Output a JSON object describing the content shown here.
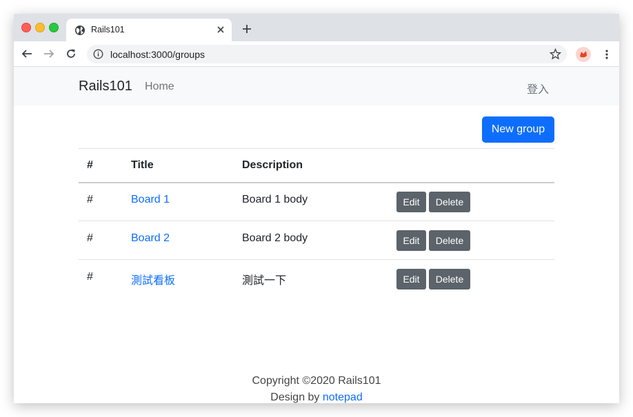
{
  "browser": {
    "tab_title": "Rails101",
    "url": "localhost:3000/groups"
  },
  "navbar": {
    "brand": "Rails101",
    "home": "Home",
    "login": "登入"
  },
  "actions": {
    "new_group": "New group"
  },
  "table": {
    "headers": [
      "#",
      "Title",
      "Description"
    ],
    "rows": [
      {
        "hash": "#",
        "title": "Board 1",
        "description": "Board 1 body",
        "edit": "Edit",
        "delete": "Delete"
      },
      {
        "hash": "#",
        "title": "Board 2",
        "description": "Board 2 body",
        "edit": "Edit",
        "delete": "Delete"
      },
      {
        "hash": "#",
        "title": "測試看板",
        "description": "測試一下",
        "edit": "Edit",
        "delete": "Delete"
      }
    ]
  },
  "footer": {
    "copyright": "Copyright ©2020 Rails101",
    "design_prefix": "Design by ",
    "design_link": "notepad"
  },
  "colors": {
    "primary": "#0d6efd",
    "secondary": "#5c636a",
    "navbar_bg": "#f8f9fa"
  }
}
